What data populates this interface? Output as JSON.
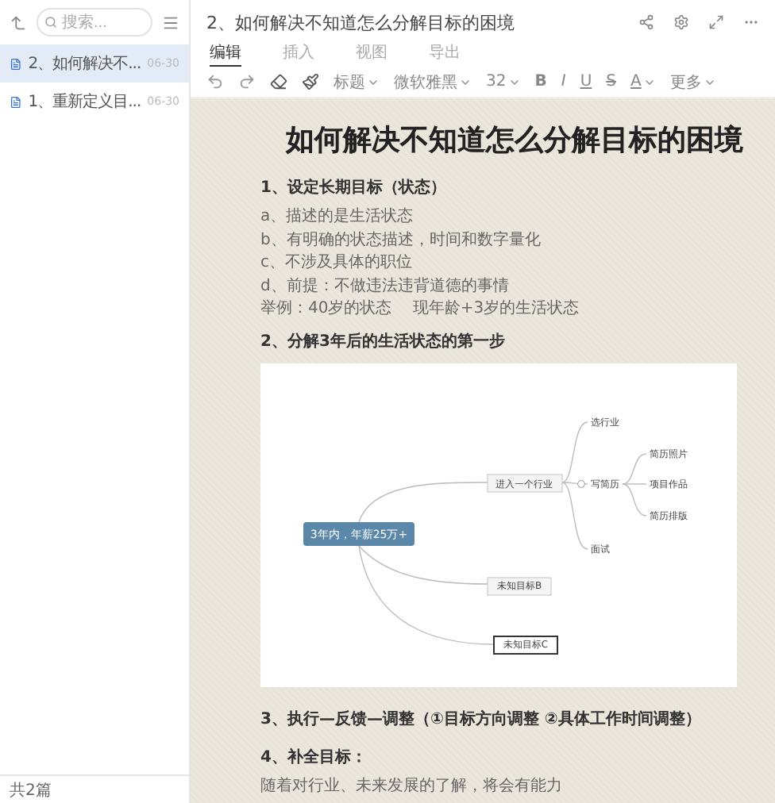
{
  "sidebar": {
    "search": {
      "placeholder": "搜索..."
    },
    "items": [
      {
        "title": "2、如何解决不...",
        "date": "06-30",
        "selected": true
      },
      {
        "title": "1、重新定义目...",
        "date": "06-30",
        "selected": false
      }
    ],
    "footer": "共2篇"
  },
  "document_title": "2、如何解决不知道怎么分解目标的困境",
  "tabs": [
    {
      "label": "编辑",
      "selected": true
    },
    {
      "label": "插入",
      "selected": false
    },
    {
      "label": "视图",
      "selected": false
    },
    {
      "label": "导出",
      "selected": false
    }
  ],
  "toolbar": [
    {
      "kind": "undo"
    },
    {
      "kind": "redo"
    },
    {
      "kind": "eraser"
    },
    {
      "kind": "painter"
    },
    {
      "kind": "dropdown",
      "label": "标题"
    },
    {
      "kind": "dropdown",
      "label": "微软雅黑"
    },
    {
      "kind": "dropdown",
      "label": "32"
    },
    {
      "kind": "format",
      "label": "B"
    },
    {
      "kind": "format",
      "label": "I"
    },
    {
      "kind": "format",
      "label": "U"
    },
    {
      "kind": "format",
      "label": "S"
    },
    {
      "kind": "color",
      "label": "A"
    },
    {
      "kind": "dropdown",
      "label": "更多"
    }
  ],
  "content": {
    "title": "如何解决不知道怎么分解目标的困境",
    "blocks": [
      {
        "kind": "heading",
        "text": "1、设定长期目标（状态）"
      },
      {
        "kind": "line",
        "text": "a、描述的是生活状态"
      },
      {
        "kind": "line",
        "text": "b、有明确的状态描述，时间和数字量化"
      },
      {
        "kind": "line",
        "text": "c、不涉及具体的职位"
      },
      {
        "kind": "line",
        "text": "d、前提：不做违法违背道德的事情"
      },
      {
        "kind": "line",
        "text": "举例：40岁的状态　 现年龄+3岁的生活状态"
      },
      {
        "kind": "heading",
        "text": "2、分解3年后的生活状态的第一步"
      },
      {
        "kind": "mindmap"
      },
      {
        "kind": "heading",
        "text": "3、执行—反馈—调整（①目标方向调整 ②具体工作时间调整）"
      },
      {
        "kind": "heading",
        "text": "4、补全目标："
      },
      {
        "kind": "line",
        "text": "随着对行业、未来发展的了解，将会有能力"
      }
    ]
  },
  "mindmap": {
    "root": "3年内，年薪25万+",
    "branch": "进入一个行业",
    "steps": [
      "选行业",
      "写简历",
      "面试"
    ],
    "resume": [
      "简历照片",
      "项目作品",
      "简历排版"
    ],
    "others": [
      "未知目标B",
      "未知目标C"
    ]
  }
}
